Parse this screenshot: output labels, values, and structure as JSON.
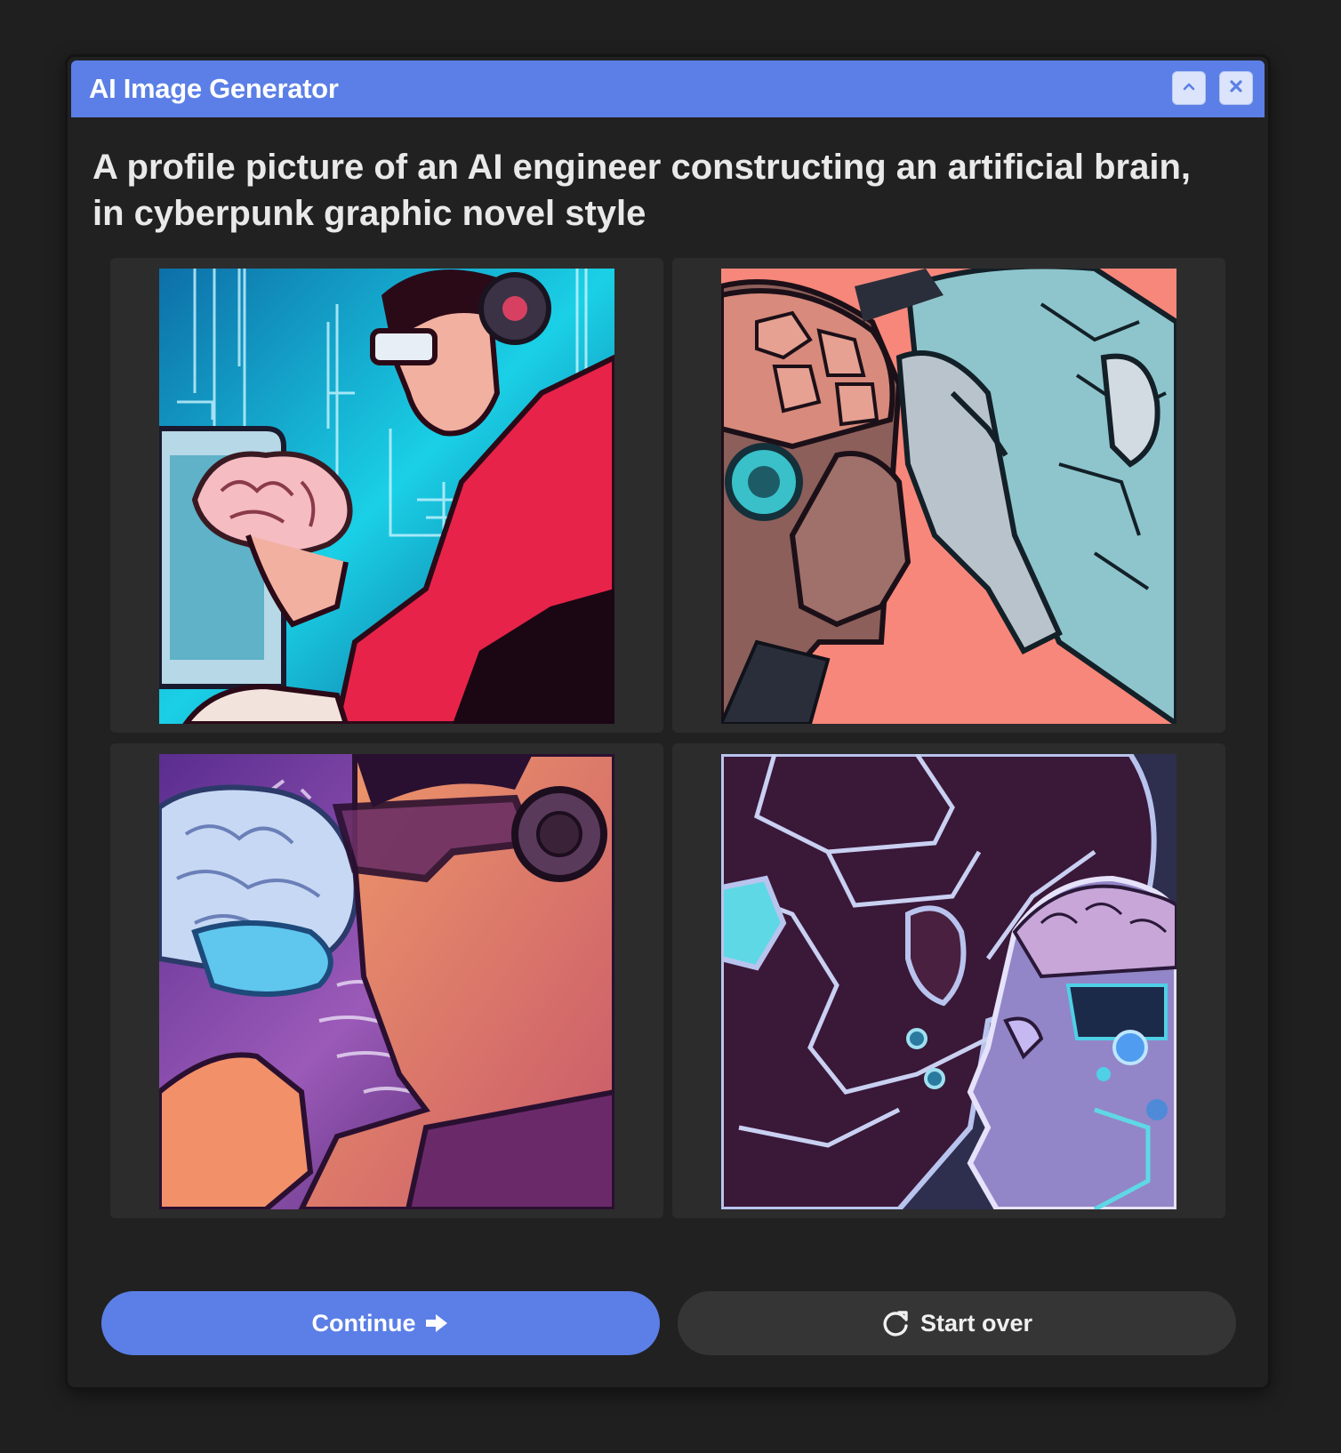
{
  "window": {
    "title": "AI Image Generator"
  },
  "prompt": "A profile picture of an AI engineer constructing an artificial brain, in cyberpunk graphic novel style",
  "images": [
    {
      "name": "engineer-holding-brain"
    },
    {
      "name": "two-cyborg-profiles"
    },
    {
      "name": "engineer-with-glowing-brain"
    },
    {
      "name": "cyborg-head-circuit"
    }
  ],
  "actions": {
    "continue_label": "Continue",
    "start_over_label": "Start over"
  },
  "colors": {
    "accent": "#5b7fe6",
    "background": "#1f1f1f",
    "panel": "#212121",
    "tile": "#2c2c2c"
  },
  "icons": {
    "collapse": "chevron-up-icon",
    "close": "close-icon",
    "continue": "arrow-right-icon",
    "start_over": "refresh-icon"
  }
}
